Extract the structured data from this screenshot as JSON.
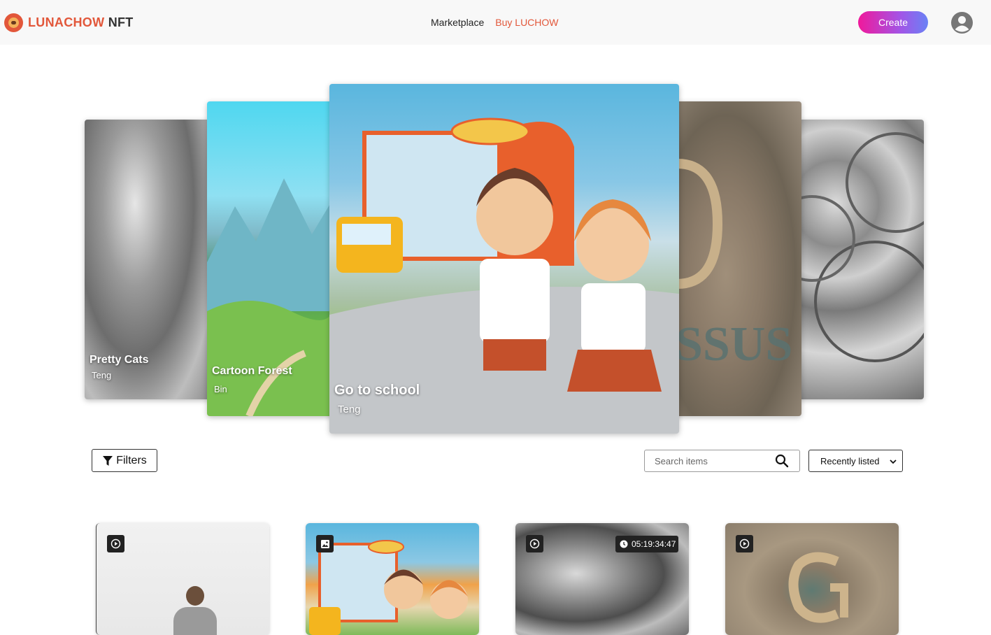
{
  "brand": {
    "part1": "LUNACHOW",
    "part2": "NFT",
    "accent_color": "#e2573a"
  },
  "nav": {
    "links": [
      {
        "label": "Marketplace"
      },
      {
        "label": "Buy LUCHOW"
      }
    ],
    "create_label": "Create"
  },
  "carousel": {
    "slides": [
      {
        "title": "Pretty Cats",
        "author": "Teng"
      },
      {
        "title": "Cartoon Forest",
        "author": "Bin"
      },
      {
        "title": "Go to school",
        "author": "Teng"
      },
      {
        "title": "",
        "author": ""
      },
      {
        "title": "",
        "author": ""
      }
    ]
  },
  "toolbar": {
    "filters_label": "Filters",
    "search_placeholder": "Search items",
    "sort_selected": "Recently listed"
  },
  "cards": [
    {
      "media_icon": "play-circle-icon"
    },
    {
      "media_icon": "image-icon"
    },
    {
      "media_icon": "play-circle-icon",
      "timer": "05:19:34:47"
    },
    {
      "media_icon": "play-circle-icon"
    }
  ]
}
